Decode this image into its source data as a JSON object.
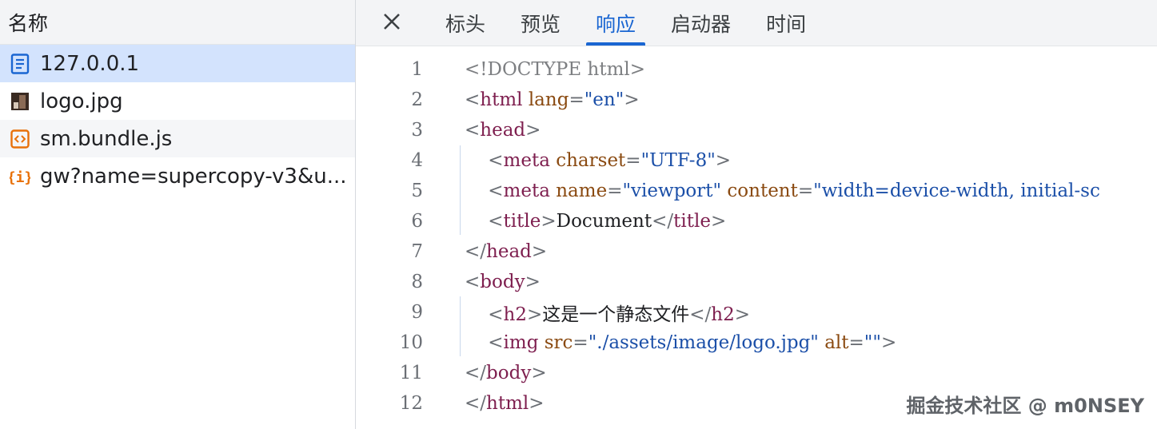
{
  "left_panel": {
    "header": "名称",
    "files": [
      {
        "name": "127.0.0.1",
        "icon": "document-icon"
      },
      {
        "name": "logo.jpg",
        "icon": "image-thumbnail-icon"
      },
      {
        "name": "sm.bundle.js",
        "icon": "script-icon"
      },
      {
        "name": "gw?name=supercopy-v3&u...",
        "icon": "json-icon"
      }
    ]
  },
  "tabs": {
    "close_icon": "close-icon",
    "items": [
      "标头",
      "预览",
      "响应",
      "启动器",
      "时间"
    ],
    "active": "响应"
  },
  "code": {
    "line_numbers": [
      "1",
      "2",
      "3",
      "4",
      "5",
      "6",
      "7",
      "8",
      "9",
      "10",
      "11",
      "12"
    ]
  },
  "watermark": "掘金技术社区 @ m0NSEY",
  "colors": {
    "accent": "#1a66d2",
    "selected_row": "#d3e3fd",
    "tag": "#7e1f4f",
    "attribute": "#8a4a11",
    "value": "#1b4fa8"
  }
}
